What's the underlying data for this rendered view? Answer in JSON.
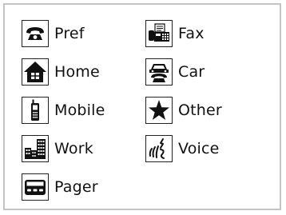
{
  "legend": {
    "items": [
      {
        "key": "pref",
        "label": "Pref",
        "icon": "telephone-icon"
      },
      {
        "key": "fax",
        "label": "Fax",
        "icon": "fax-machine-icon"
      },
      {
        "key": "home",
        "label": "Home",
        "icon": "house-icon"
      },
      {
        "key": "car",
        "label": "Car",
        "icon": "car-phone-icon"
      },
      {
        "key": "mobile",
        "label": "Mobile",
        "icon": "mobile-phone-icon"
      },
      {
        "key": "other",
        "label": "Other",
        "icon": "star-icon"
      },
      {
        "key": "work",
        "label": "Work",
        "icon": "office-buildings-icon"
      },
      {
        "key": "voice",
        "label": "Voice",
        "icon": "voice-icon"
      },
      {
        "key": "pager",
        "label": "Pager",
        "icon": "pager-icon"
      }
    ]
  }
}
